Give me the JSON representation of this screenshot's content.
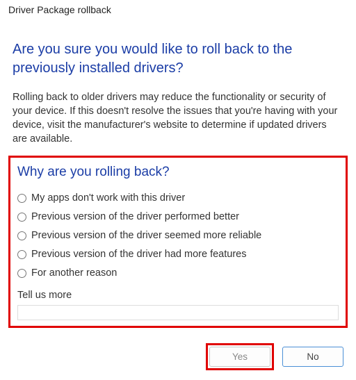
{
  "window": {
    "title": "Driver Package rollback"
  },
  "heading": "Are you sure you would like to roll back to the previously installed drivers?",
  "body": "Rolling back to older drivers may reduce the functionality or security of your device. If this doesn't resolve the issues that you're having with your device, visit the manufacturer's website to determine if updated drivers are available.",
  "survey": {
    "question": "Why are you rolling back?",
    "options": [
      "My apps don't work with this driver",
      "Previous version of the driver performed better",
      "Previous version of the driver seemed more reliable",
      "Previous version of the driver had more features",
      "For another reason"
    ],
    "tell_us_more": "Tell us more",
    "textbox_value": ""
  },
  "buttons": {
    "yes": "Yes",
    "no": "No"
  },
  "colors": {
    "accent_blue": "#1b3da6",
    "highlight_red": "#e00000"
  }
}
